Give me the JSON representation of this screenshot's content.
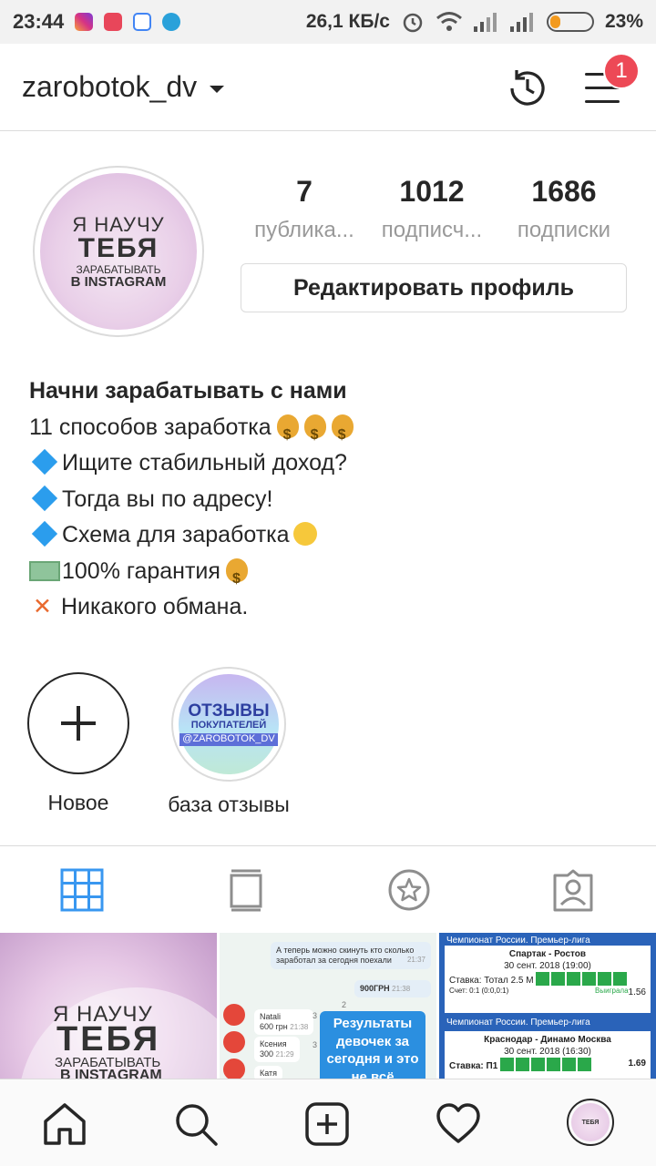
{
  "status_bar": {
    "time": "23:44",
    "network_speed": "26,1 КБ/с",
    "battery_percent": "23%",
    "battery_level": 0.23,
    "app_icons": [
      "instagram-icon",
      "pocket-icon",
      "google-icon",
      "telegram-icon"
    ]
  },
  "header": {
    "username": "zarobotok_dv",
    "notification_count": "1",
    "icons": [
      "chevron-down-icon",
      "history-icon",
      "menu-icon"
    ]
  },
  "profile": {
    "avatar_text": {
      "line1": "Я НАУЧУ",
      "line2": "ТЕБЯ",
      "line3": "ЗАРАБАТЫВАТЬ",
      "line4": "В INSTAGRAM"
    },
    "stats": [
      {
        "value": "7",
        "label": "публика..."
      },
      {
        "value": "1012",
        "label": "подписч..."
      },
      {
        "value": "1686",
        "label": "подписки"
      }
    ],
    "edit_button": "Редактировать профиль"
  },
  "bio": {
    "name": "Начни зарабатывать с нами",
    "lines": [
      "11 способов заработка",
      "Ищите стабильный доход?",
      "Тогда вы по адресу!",
      "Схема для заработка",
      "100% гарантия",
      "Никакого обмана."
    ],
    "x_mark": "✕"
  },
  "highlights": [
    {
      "label": "Новое"
    },
    {
      "label": "база отзывы",
      "cover_text": {
        "line1": "ОТЗЫВЫ",
        "line2": "ПОКУПАТЕЛЕЙ",
        "line3": "@ZAROBOTOK_DV"
      }
    }
  ],
  "tabs": [
    "grid-icon",
    "feed-icon",
    "saved-star-icon",
    "tagged-icon"
  ],
  "posts": {
    "post1": {
      "line1": "Я НАУЧУ",
      "line2": "ТЕБЯ",
      "line3": "ЗАРАБАТЫВАТЬ",
      "line4": "В INSTAGRAM"
    },
    "post2": {
      "message": "А теперь можно скинуть кто сколько заработал за сегодня поехали",
      "msg_time": "21:37",
      "amount": "900ГРН",
      "amount_time": "21:38",
      "entries": [
        {
          "name": "Natali",
          "amount": "600 грн",
          "time": "21:38"
        },
        {
          "name": "Ксения",
          "amount": "300",
          "time": "21:29"
        },
        {
          "name": "Катя",
          "amount": "",
          "time": ""
        }
      ],
      "counts": [
        "2",
        "3",
        "3"
      ],
      "result_text": "Результаты девочек за сегодня и это не всё"
    },
    "post3": {
      "league": "Чемпионат России. Премьер-лига",
      "match1": "Спартак - Ростов",
      "date1": "30 сент. 2018 (19:00)",
      "bet1": "Ставка: Тотал 2.5 М",
      "odds1": "1.56",
      "score1": "Счет: 0:1 (0:0,0:1)",
      "status1": "Выиграла",
      "match2": "Краснодар - Динамо Москва",
      "date2": "30 сент. 2018 (16:30)",
      "bet2": "Ставка: П1",
      "odds2": "1.69"
    }
  },
  "bottom_nav": [
    "home-icon",
    "search-icon",
    "new-post-icon",
    "activity-heart-icon",
    "profile-avatar"
  ],
  "colors": {
    "accent_blue": "#3897f0",
    "badge_red": "#ed4956",
    "border": "#dbdbdb",
    "text": "#262626",
    "muted": "#999999"
  }
}
